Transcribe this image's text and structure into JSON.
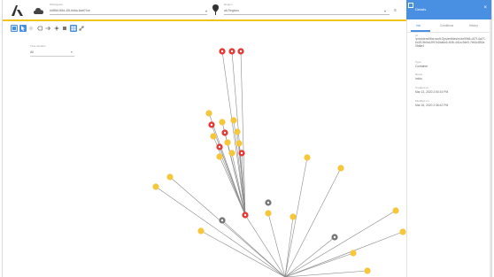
{
  "topbar": {
    "project_label": "Workspace",
    "project_value": "#df5bf-f48d-45f-bb6a-6ae07ce",
    "region_label": "Region",
    "region_value": "all-Regions",
    "dropdown_caret": "▾",
    "overflow_glyph": "≡"
  },
  "toolbar": {
    "tools": [
      "select-icon",
      "arrow-icon",
      "hidden-icon",
      "tag-icon",
      "hub-icon",
      "layers-icon",
      "stop-icon",
      "grid-icon",
      "link-icon"
    ]
  },
  "filter": {
    "label": "Time window",
    "value": "All",
    "caret": "▾"
  },
  "panel": {
    "title": "Details",
    "close_glyph": "×",
    "tabs": [
      "Info",
      "Conditions",
      "History"
    ],
    "active_tab": 0,
    "fields": [
      {
        "label": "Id",
        "value": "/providers/Microsoft.Ops/entities/ec4e99b6-c57f-4a27-bc25-5b0a12f97e2da6c6-f43b-4d1a-9de3-7b61c852a0fd6e4"
      },
      {
        "label": "Type",
        "value": "Container"
      },
      {
        "label": "Name",
        "value": "infolo"
      },
      {
        "label": "Created on",
        "value": "Mar 13, 2020 2:50:15 PM"
      },
      {
        "label": "Modified on",
        "value": "Mar 16, 2020 2:36:42 PM"
      }
    ]
  },
  "colors": {
    "accent": "#4a90e2",
    "topbar_underline": "#f0c419",
    "node_yellow": "#f6c63b",
    "node_red": "#e53935",
    "node_gray": "#777777"
  }
}
